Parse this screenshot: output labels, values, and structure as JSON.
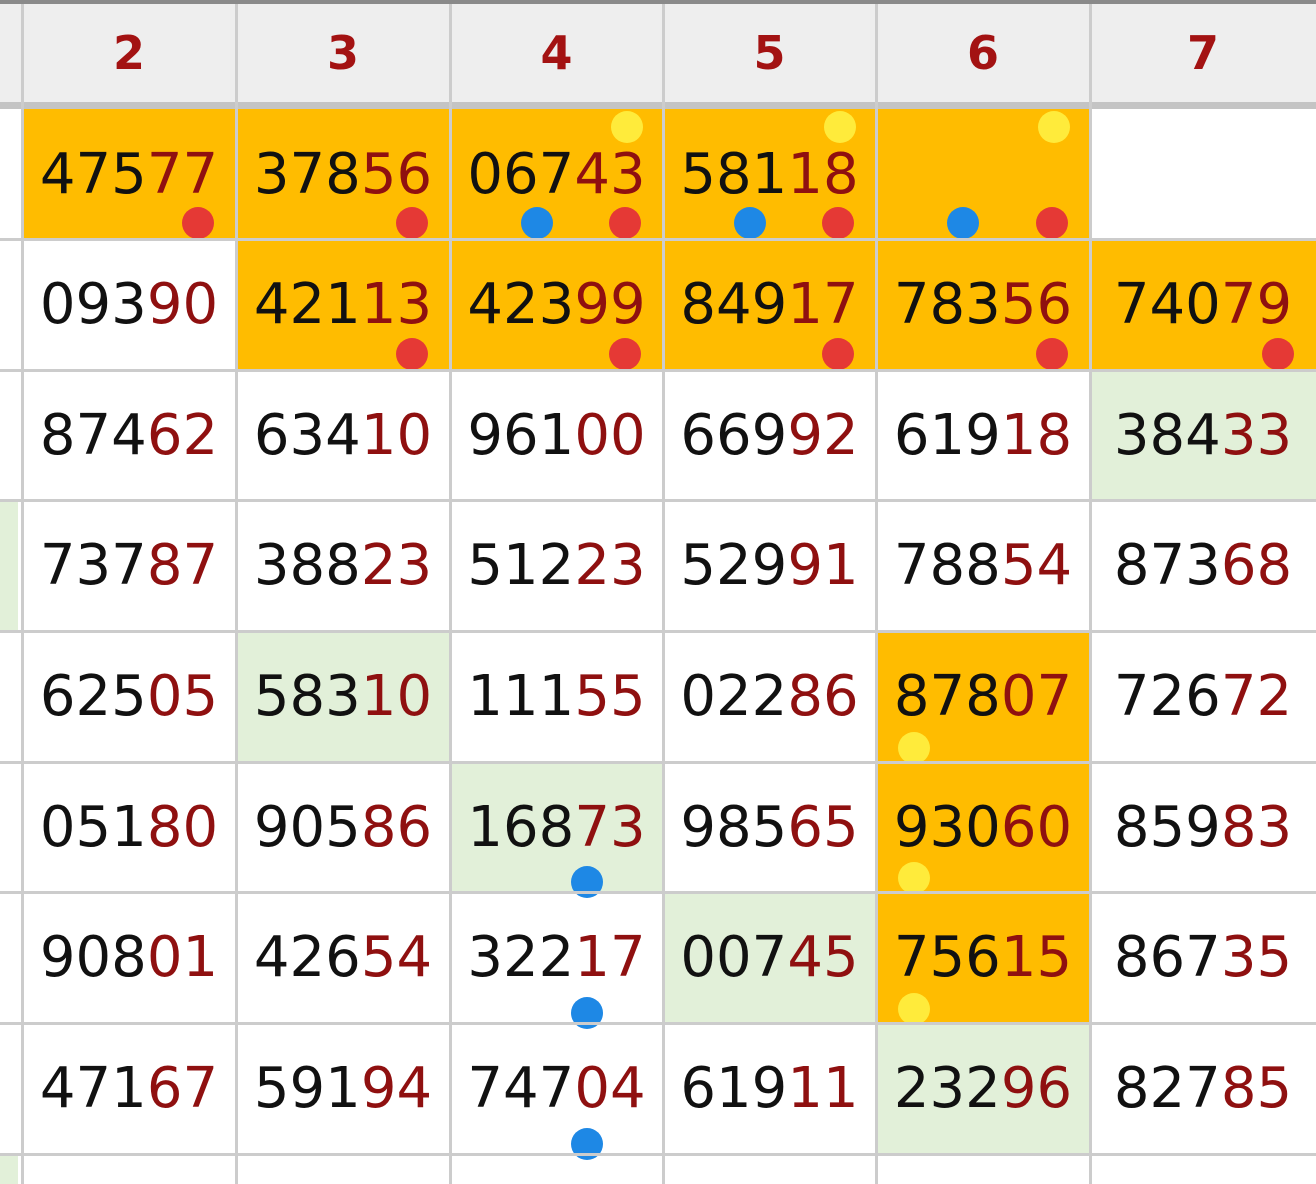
{
  "colors": {
    "header_text": "#a31212",
    "highlight_orange": "#ffbc00",
    "highlight_green": "#e2f0d9",
    "tail_digits": "#8f1010",
    "dot_red": "#e53935",
    "dot_blue": "#1e88e5",
    "dot_yellow": "#ffeb3b"
  },
  "columns": [
    "2",
    "3",
    "4",
    "5",
    "6",
    "7"
  ],
  "rows": [
    {
      "cells": [
        {
          "head": "475",
          "tail": "77",
          "fill": "orange",
          "dots": [
            "red"
          ]
        },
        {
          "head": "378",
          "tail": "56",
          "fill": "orange",
          "dots": [
            "red"
          ]
        },
        {
          "head": "067",
          "tail": "43",
          "fill": "orange",
          "dots": [
            "yellow-top",
            "blue",
            "red"
          ]
        },
        {
          "head": "581",
          "tail": "18",
          "fill": "orange",
          "dots": [
            "yellow-top",
            "blue",
            "red"
          ]
        },
        {
          "head": "",
          "tail": "",
          "fill": "orange",
          "dots": [
            "yellow-top",
            "blue",
            "red"
          ]
        },
        {
          "head": "",
          "tail": "",
          "fill": "none",
          "dots": []
        }
      ]
    },
    {
      "cells": [
        {
          "head": "093",
          "tail": "90",
          "fill": "none",
          "dots": []
        },
        {
          "head": "421",
          "tail": "13",
          "fill": "orange",
          "dots": [
            "red"
          ]
        },
        {
          "head": "423",
          "tail": "99",
          "fill": "orange",
          "dots": [
            "red"
          ]
        },
        {
          "head": "849",
          "tail": "17",
          "fill": "orange",
          "dots": [
            "red"
          ]
        },
        {
          "head": "783",
          "tail": "56",
          "fill": "orange",
          "dots": [
            "red"
          ]
        },
        {
          "head": "740",
          "tail": "79",
          "fill": "orange",
          "dots": [
            "red"
          ]
        }
      ]
    },
    {
      "cells": [
        {
          "head": "874",
          "tail": "62",
          "fill": "none",
          "dots": []
        },
        {
          "head": "634",
          "tail": "10",
          "fill": "none",
          "dots": []
        },
        {
          "head": "961",
          "tail": "00",
          "fill": "none",
          "dots": []
        },
        {
          "head": "669",
          "tail": "92",
          "fill": "none",
          "dots": []
        },
        {
          "head": "619",
          "tail": "18",
          "fill": "none",
          "dots": []
        },
        {
          "head": "384",
          "tail": "33",
          "fill": "green",
          "dots": []
        }
      ]
    },
    {
      "cells": [
        {
          "head": "737",
          "tail": "87",
          "fill": "none",
          "dots": []
        },
        {
          "head": "388",
          "tail": "23",
          "fill": "none",
          "dots": []
        },
        {
          "head": "512",
          "tail": "23",
          "fill": "none",
          "dots": []
        },
        {
          "head": "529",
          "tail": "91",
          "fill": "none",
          "dots": []
        },
        {
          "head": "788",
          "tail": "54",
          "fill": "none",
          "dots": []
        },
        {
          "head": "873",
          "tail": "68",
          "fill": "none",
          "dots": []
        }
      ]
    },
    {
      "cells": [
        {
          "head": "625",
          "tail": "05",
          "fill": "none",
          "dots": []
        },
        {
          "head": "583",
          "tail": "10",
          "fill": "green",
          "dots": []
        },
        {
          "head": "111",
          "tail": "55",
          "fill": "none",
          "dots": []
        },
        {
          "head": "022",
          "tail": "86",
          "fill": "none",
          "dots": []
        },
        {
          "head": "878",
          "tail": "07",
          "fill": "orange",
          "dots": [
            "yellow-bottom"
          ]
        },
        {
          "head": "726",
          "tail": "72",
          "fill": "none",
          "dots": []
        }
      ]
    },
    {
      "cells": [
        {
          "head": "051",
          "tail": "80",
          "fill": "none",
          "dots": []
        },
        {
          "head": "905",
          "tail": "86",
          "fill": "none",
          "dots": []
        },
        {
          "head": "168",
          "tail": "73",
          "fill": "green",
          "dots": [
            "blue-bottom"
          ]
        },
        {
          "head": "985",
          "tail": "65",
          "fill": "none",
          "dots": []
        },
        {
          "head": "930",
          "tail": "60",
          "fill": "orange",
          "dots": [
            "yellow-bottom"
          ]
        },
        {
          "head": "859",
          "tail": "83",
          "fill": "none",
          "dots": []
        }
      ]
    },
    {
      "cells": [
        {
          "head": "908",
          "tail": "01",
          "fill": "none",
          "dots": []
        },
        {
          "head": "426",
          "tail": "54",
          "fill": "none",
          "dots": []
        },
        {
          "head": "322",
          "tail": "17",
          "fill": "none",
          "dots": [
            "blue-bottom"
          ]
        },
        {
          "head": "007",
          "tail": "45",
          "fill": "green",
          "dots": []
        },
        {
          "head": "756",
          "tail": "15",
          "fill": "orange",
          "dots": [
            "yellow-bottom"
          ]
        },
        {
          "head": "867",
          "tail": "35",
          "fill": "none",
          "dots": []
        }
      ]
    },
    {
      "cells": [
        {
          "head": "471",
          "tail": "67",
          "fill": "none",
          "dots": []
        },
        {
          "head": "591",
          "tail": "94",
          "fill": "none",
          "dots": []
        },
        {
          "head": "747",
          "tail": "04",
          "fill": "none",
          "dots": [
            "blue-bottom"
          ]
        },
        {
          "head": "619",
          "tail": "11",
          "fill": "none",
          "dots": []
        },
        {
          "head": "232",
          "tail": "96",
          "fill": "green",
          "dots": []
        },
        {
          "head": "827",
          "tail": "85",
          "fill": "none",
          "dots": []
        }
      ]
    }
  ]
}
